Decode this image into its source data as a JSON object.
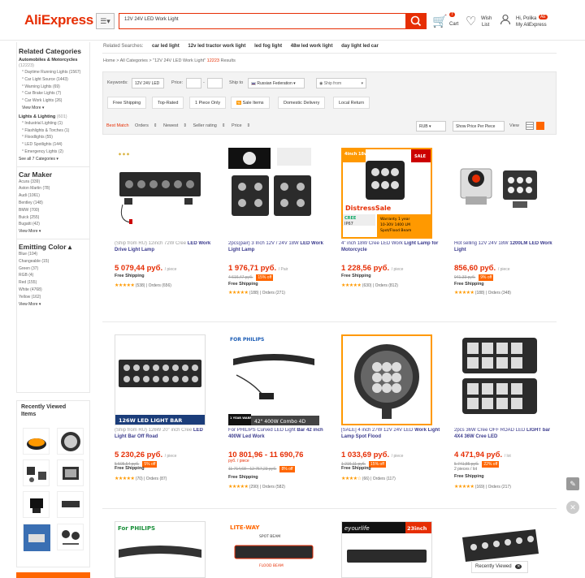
{
  "header": {
    "logo": "AliExpress",
    "search_value": "12V 24V LED Work Light",
    "cart_label": "Cart",
    "cart_count": "7",
    "wish_label": "Wish",
    "wish_label2": "List",
    "hi_label": "Hi, Polika",
    "account_label": "My AliExpress",
    "account_badge": "AE"
  },
  "sidebar": {
    "title": "Related Categories",
    "groups": [
      {
        "name": "Automobiles & Motorcycles",
        "count": "(12223)",
        "items": [
          {
            "label": "Daytime Running Lights",
            "count": "(1567)"
          },
          {
            "label": "Car Light Source",
            "count": "(1443)"
          },
          {
            "label": "Warning Lights",
            "count": "(69)"
          },
          {
            "label": "Car Brake Lights",
            "count": "(7)"
          },
          {
            "label": "Car Work Lights",
            "count": "(26)"
          }
        ],
        "more": "View More"
      },
      {
        "name": "Lights & Lighting",
        "count": "(601)",
        "items": [
          {
            "label": "Industrial Lighting",
            "count": "(1)"
          },
          {
            "label": "Flashlights & Torches",
            "count": "(1)"
          },
          {
            "label": "Floodlights",
            "count": "(55)"
          },
          {
            "label": "LED Spotlights",
            "count": "(144)"
          },
          {
            "label": "Emergency Lights",
            "count": "(2)"
          }
        ],
        "more": "See all 7 Categories"
      }
    ],
    "car_maker_title": "Car Maker",
    "car_makers": [
      {
        "label": "Acura",
        "count": "(339)"
      },
      {
        "label": "Aston Martin",
        "count": "(78)"
      },
      {
        "label": "Audi",
        "count": "(1061)"
      },
      {
        "label": "Bentley",
        "count": "(148)"
      },
      {
        "label": "BMW",
        "count": "(700)"
      },
      {
        "label": "Buick",
        "count": "(255)"
      },
      {
        "label": "Bugatti",
        "count": "(42)"
      }
    ],
    "car_more": "View More",
    "color_title": "Emitting Color",
    "colors": [
      {
        "label": "Blue",
        "count": "(104)"
      },
      {
        "label": "Changeable",
        "count": "(15)"
      },
      {
        "label": "Green",
        "count": "(37)"
      },
      {
        "label": "RGB",
        "count": "(4)"
      },
      {
        "label": "Red",
        "count": "(155)"
      },
      {
        "label": "White",
        "count": "(4768)"
      },
      {
        "label": "Yellow",
        "count": "(162)"
      }
    ],
    "color_more": "View More",
    "recent_title": "Recently Viewed Items"
  },
  "related": {
    "label": "Related Searches:",
    "items": [
      "car led light",
      "12v led tractor work light",
      "led fog light",
      "48w led work light",
      "day light led car"
    ]
  },
  "breadcrumb": {
    "home": "Home",
    "all": "All Categories",
    "query": "\"12V 24V LED Work Light\"",
    "count": "12223",
    "results": "Results"
  },
  "filters": {
    "keywords_label": "Keywords:",
    "keywords_value": "12V 24V LED",
    "price_label": "Price:",
    "ship_to_label": "Ship to",
    "ship_to_value": "Russian Federation",
    "ship_from_value": "Ship from",
    "buttons": [
      "Free Shipping",
      "Top-Rated",
      "1 Piece Only",
      "Sale Items",
      "Domestic Delivery",
      "Local Return"
    ],
    "sort": [
      "Best Match",
      "Orders",
      "Newest",
      "Seller rating",
      "Price"
    ],
    "currency": "RUB",
    "show_price": "Show Price Per Piece",
    "view_label": "View"
  },
  "products": [
    {
      "title_pre": "(Ship from RU) 12inch 72W Cree",
      "title": "LED Work Drive Light Lamp",
      "price": "5 079,44 руб.",
      "unit": "/ piece",
      "old": "",
      "off": "",
      "ship": "Free Shipping",
      "rating": "(538)",
      "orders": "Orders (656)"
    },
    {
      "title_pre": "2pcs(pair) 3 Inch 12V / 24V 18W",
      "title": "LED Work Light Lamp",
      "price": "1 976,71 руб.",
      "unit": "/ Pair",
      "old": "4 616,47 руб.",
      "off": "15% off",
      "ship": "Free Shipping",
      "rating": "(188)",
      "orders": "Orders (271)"
    },
    {
      "title_pre": "4\" inch 18W Cree LED Work",
      "title": "Light Lamp for Motorcycle",
      "price": "1 228,56 руб.",
      "unit": "/ piece",
      "old": "",
      "off": "",
      "ship": "Free Shipping",
      "rating": "(630)",
      "orders": "Orders (812)"
    },
    {
      "title_pre": "Hot selling 12V 24V 18W",
      "title": "1200LM LED Work Light",
      "price": "856,60 руб.",
      "unit": "/ piece",
      "old": "941,33 руб.",
      "off": "9% off",
      "ship": "Free Shipping",
      "rating": "(188)",
      "orders": "Orders (348)"
    },
    {
      "title_pre": "(Ship from RU) 126W 20\" inch Cree",
      "title": "LED Light Bar Off Road",
      "price": "5 230,26 руб.",
      "unit": "/ piece",
      "old": "5 505,54 руб.",
      "off": "5% off",
      "ship": "Free Shipping",
      "rating": "(70)",
      "orders": "Orders (87)"
    },
    {
      "title_pre": "For PHILIPS Curved LED Light",
      "title": "Bar 42 inch 400W Led Work",
      "price": "10 801,96 - 11 690,76",
      "unit": "руб. / piece",
      "old": "11 714,68 - 12 757,23 руб.",
      "off": "8% off",
      "ship": "Free Shipping",
      "rating": "(290)",
      "orders": "Orders (582)"
    },
    {
      "title_pre": "[SALE] 4 inch 27W 12V 24V LED",
      "title": "Work Light Lamp Spot Flood",
      "price": "1 033,69 руб.",
      "unit": "/ piece",
      "old": "1 216,11 руб.",
      "off": "15% off",
      "ship": "Free Shipping",
      "rating": "(66)",
      "orders": "Orders (117)"
    },
    {
      "title_pre": "2pcs 36W Cree OFF ROAD LED",
      "title": "LIGHT bar 4X4 36W Cree LED",
      "price": "4 471,94 руб.",
      "unit": "/ lot",
      "old": "5 741,85 руб.",
      "off": "22% off",
      "ship": "Free Shipping",
      "rating": "(169)",
      "orders": "Orders (217)",
      "extra": "2 pieces / lot"
    }
  ],
  "image_labels": {
    "p3_top": "4inch 18w",
    "p3_sale": "SALE",
    "p3_distress": "DistressSale",
    "p3_warranty": "Warranty 1 year",
    "p3_spec": "10-30V 1400 LM",
    "p3_beam": "Spot/Flood Beam",
    "p3_cree": "CREE",
    "p3_ip": "IP67",
    "p5_label": "126W LED LIGHT BAR",
    "p6_brand": "FOR PHILIPS",
    "p6_warranty": "1 YEAR WARRANTY",
    "p6_label": "42\" 400W Combo 4D",
    "p9_brand": "For PHILIPS",
    "p10_brand": "LITE-WAY",
    "p10_spot": "SPOT BEAM",
    "p10_flood": "FLOOD BEAM",
    "p11_brand": "eyourlife",
    "p11_size": "23inch"
  },
  "recently_viewed_bar": "Recently Viewed",
  "colors": {
    "accent": "#e62e04",
    "link": "#3c3c8e",
    "star": "#ff9900"
  }
}
